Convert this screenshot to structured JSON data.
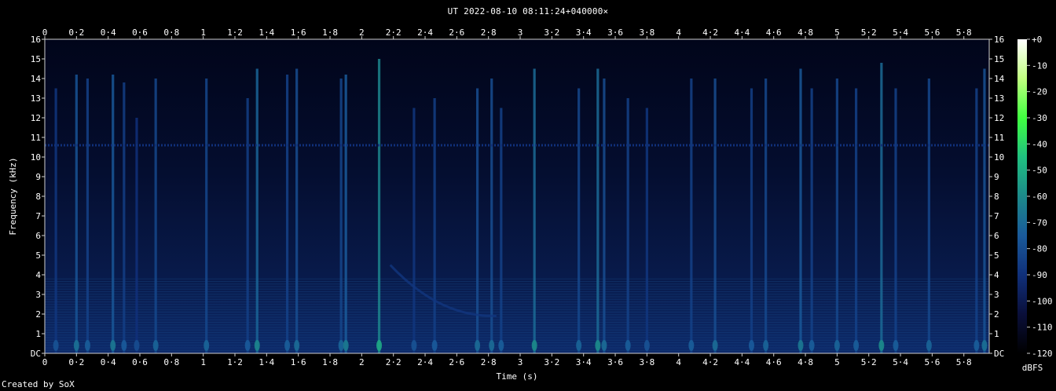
{
  "title": "UT 2022-08-10 08:11:24+040000×",
  "credit": "Created by SoX",
  "chart_data": {
    "type": "heatmap",
    "title": "UT 2022-08-10 08:11:24+040000×",
    "xlabel": "Time (s)",
    "ylabel": "Frequency (kHz)",
    "xlim": [
      0,
      5.96
    ],
    "ylim": [
      0,
      16
    ],
    "x_ticks": [
      "0",
      "0·2",
      "0·4",
      "0·6",
      "0·8",
      "1",
      "1·2",
      "1·4",
      "1·6",
      "1·8",
      "2",
      "2·2",
      "2·4",
      "2·6",
      "2·8",
      "3",
      "3·2",
      "3·4",
      "3·6",
      "3·8",
      "4",
      "4·2",
      "4·4",
      "4·6",
      "4·8",
      "5",
      "5·2",
      "5·4",
      "5·6",
      "5·8"
    ],
    "x_tick_values": [
      0,
      0.2,
      0.4,
      0.6,
      0.8,
      1,
      1.2,
      1.4,
      1.6,
      1.8,
      2,
      2.2,
      2.4,
      2.6,
      2.8,
      3,
      3.2,
      3.4,
      3.6,
      3.8,
      4,
      4.2,
      4.4,
      4.6,
      4.8,
      5,
      5.2,
      5.4,
      5.6,
      5.8
    ],
    "y_ticks": [
      "DC",
      "1",
      "2",
      "3",
      "4",
      "5",
      "6",
      "7",
      "8",
      "9",
      "10",
      "11",
      "12",
      "13",
      "14",
      "15",
      "16"
    ],
    "y_tick_values": [
      0,
      1,
      2,
      3,
      4,
      5,
      6,
      7,
      8,
      9,
      10,
      11,
      12,
      13,
      14,
      15,
      16
    ],
    "colorbar": {
      "label": "dBFS",
      "ticks": [
        "+0",
        "-10",
        "-20",
        "-30",
        "-40",
        "-50",
        "-60",
        "-70",
        "-80",
        "-90",
        "-100",
        "-110",
        "-120"
      ],
      "tick_values": [
        0,
        -10,
        -20,
        -30,
        -40,
        -50,
        -60,
        -70,
        -80,
        -90,
        -100,
        -110,
        -120
      ],
      "range": [
        -120,
        0
      ],
      "colors": [
        "#000000",
        "#0a0f3a",
        "#10307a",
        "#1a5a9a",
        "#1c8a8a",
        "#20c080",
        "#40ff40",
        "#c0ff80",
        "#ffffff"
      ]
    },
    "background_dbfs": -105,
    "tone_line": {
      "freq_khz": 10.6,
      "dbfs": -90
    },
    "sferics": [
      {
        "t": 0.07,
        "top_khz": 13.5,
        "dbfs": -88
      },
      {
        "t": 0.2,
        "top_khz": 14.2,
        "dbfs": -78
      },
      {
        "t": 0.27,
        "top_khz": 14.0,
        "dbfs": -84
      },
      {
        "t": 0.43,
        "top_khz": 14.2,
        "dbfs": -76
      },
      {
        "t": 0.5,
        "top_khz": 13.8,
        "dbfs": -85
      },
      {
        "t": 0.58,
        "top_khz": 12.0,
        "dbfs": -90
      },
      {
        "t": 0.7,
        "top_khz": 14.0,
        "dbfs": -82
      },
      {
        "t": 1.02,
        "top_khz": 14.0,
        "dbfs": -82
      },
      {
        "t": 1.28,
        "top_khz": 13.0,
        "dbfs": -85
      },
      {
        "t": 1.34,
        "top_khz": 14.5,
        "dbfs": -72
      },
      {
        "t": 1.53,
        "top_khz": 14.2,
        "dbfs": -84
      },
      {
        "t": 1.59,
        "top_khz": 14.5,
        "dbfs": -80
      },
      {
        "t": 1.87,
        "top_khz": 14.0,
        "dbfs": -82
      },
      {
        "t": 1.9,
        "top_khz": 14.2,
        "dbfs": -75
      },
      {
        "t": 2.11,
        "top_khz": 15.0,
        "dbfs": -62
      },
      {
        "t": 2.33,
        "top_khz": 12.5,
        "dbfs": -88
      },
      {
        "t": 2.46,
        "top_khz": 13.0,
        "dbfs": -85
      },
      {
        "t": 2.73,
        "top_khz": 13.5,
        "dbfs": -80
      },
      {
        "t": 2.82,
        "top_khz": 14.0,
        "dbfs": -80
      },
      {
        "t": 2.88,
        "top_khz": 12.5,
        "dbfs": -84
      },
      {
        "t": 3.09,
        "top_khz": 14.5,
        "dbfs": -70
      },
      {
        "t": 3.37,
        "top_khz": 13.5,
        "dbfs": -82
      },
      {
        "t": 3.49,
        "top_khz": 14.5,
        "dbfs": -70
      },
      {
        "t": 3.53,
        "top_khz": 14.0,
        "dbfs": -80
      },
      {
        "t": 3.68,
        "top_khz": 13.0,
        "dbfs": -84
      },
      {
        "t": 3.8,
        "top_khz": 12.5,
        "dbfs": -88
      },
      {
        "t": 4.08,
        "top_khz": 14.0,
        "dbfs": -84
      },
      {
        "t": 4.23,
        "top_khz": 14.0,
        "dbfs": -80
      },
      {
        "t": 4.46,
        "top_khz": 13.5,
        "dbfs": -85
      },
      {
        "t": 4.55,
        "top_khz": 14.0,
        "dbfs": -82
      },
      {
        "t": 4.77,
        "top_khz": 14.5,
        "dbfs": -76
      },
      {
        "t": 4.84,
        "top_khz": 13.5,
        "dbfs": -84
      },
      {
        "t": 5.0,
        "top_khz": 14.0,
        "dbfs": -82
      },
      {
        "t": 5.12,
        "top_khz": 13.5,
        "dbfs": -84
      },
      {
        "t": 5.28,
        "top_khz": 14.8,
        "dbfs": -70
      },
      {
        "t": 5.37,
        "top_khz": 13.5,
        "dbfs": -84
      },
      {
        "t": 5.58,
        "top_khz": 14.0,
        "dbfs": -82
      },
      {
        "t": 5.88,
        "top_khz": 13.5,
        "dbfs": -84
      },
      {
        "t": 5.93,
        "top_khz": 14.5,
        "dbfs": -78
      }
    ],
    "tweek": {
      "t_start": 2.18,
      "t_end": 2.85,
      "f_start_khz": 4.5,
      "f_end_khz": 1.9,
      "dbfs": -88
    }
  }
}
